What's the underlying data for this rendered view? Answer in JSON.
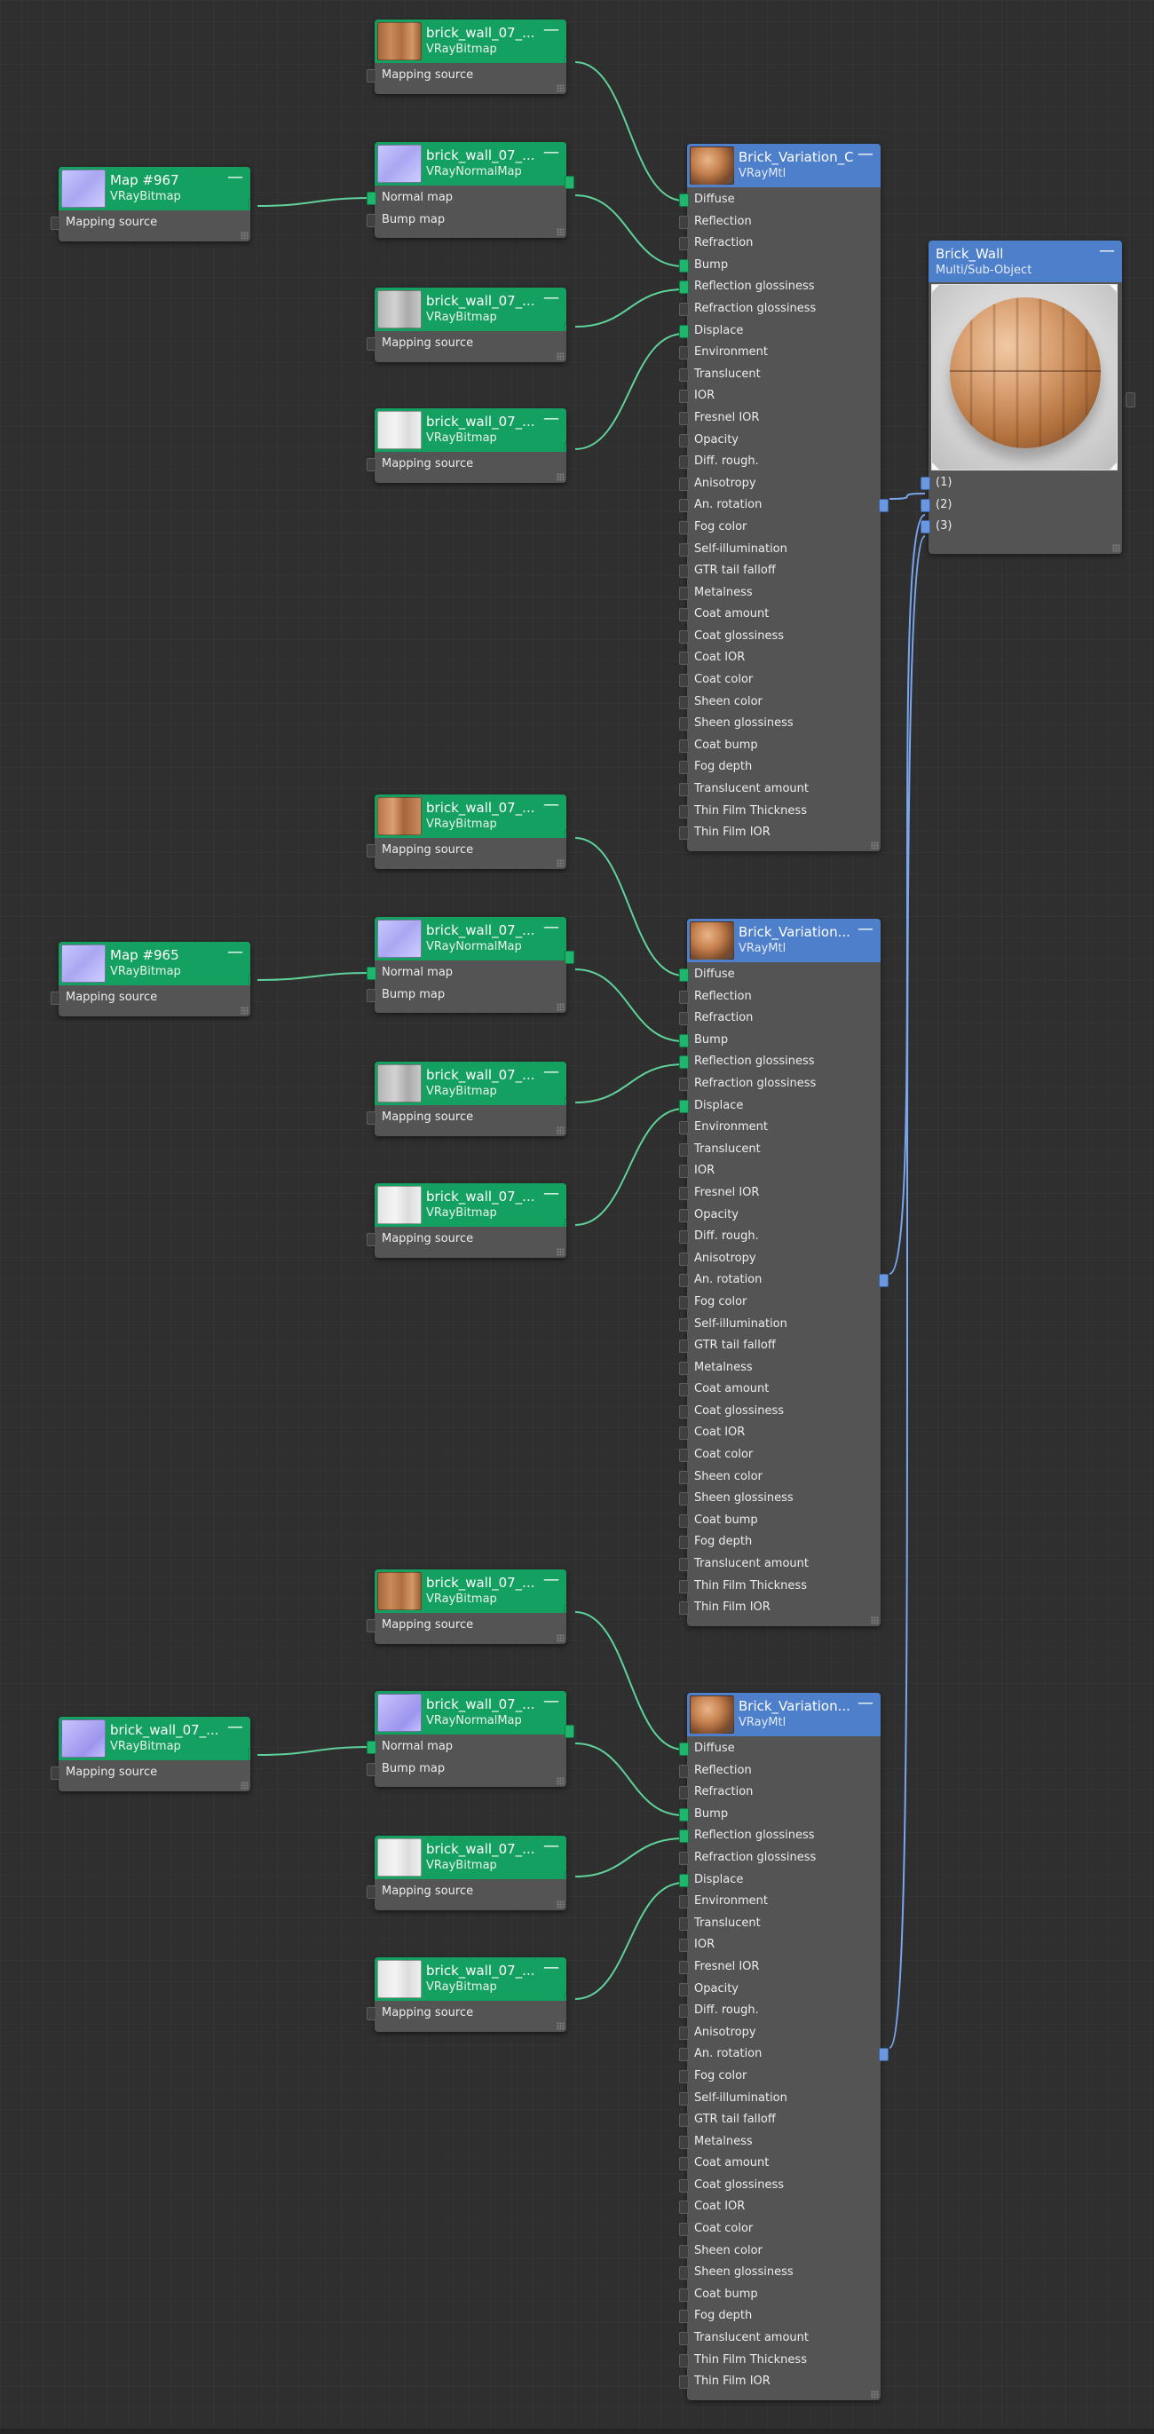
{
  "multi_node": {
    "title": "Brick_Wall",
    "subtitle": "Multi/Sub-Object",
    "slots": [
      "(1)",
      "(2)",
      "(3)"
    ]
  },
  "materials": [
    {
      "title": "Brick_Variation_C",
      "subtitle": "VRayMtl",
      "slots": [
        "Diffuse",
        "Reflection",
        "Refraction",
        "Bump",
        "Reflection glossiness",
        "Refraction glossiness",
        "Displace",
        "Environment",
        "Translucent",
        "IOR",
        "Fresnel IOR",
        "Opacity",
        "Diff. rough.",
        "Anisotropy",
        "An. rotation",
        "Fog color",
        "Self-illumination",
        "GTR tail falloff",
        "Metalness",
        "Coat amount",
        "Coat glossiness",
        "Coat IOR",
        "Coat color",
        "Sheen color",
        "Sheen glossiness",
        "Coat bump",
        "Fog depth",
        "Translucent amount",
        "Thin Film Thickness",
        "Thin Film IOR"
      ],
      "bitmaps": [
        {
          "title": "brick_wall_07_...",
          "subtitle": "VRayBitmap",
          "slots": [
            "Mapping source"
          ]
        },
        {
          "title": "brick_wall_07_...",
          "subtitle": "VRayNormalMap",
          "slots": [
            "Normal map",
            "Bump map"
          ]
        },
        {
          "title": "brick_wall_07_...",
          "subtitle": "VRayBitmap",
          "slots": [
            "Mapping source"
          ]
        },
        {
          "title": "brick_wall_07_...",
          "subtitle": "VRayBitmap",
          "slots": [
            "Mapping source"
          ]
        }
      ],
      "source_map": {
        "title": "Map #967",
        "subtitle": "VRayBitmap",
        "slots": [
          "Mapping source"
        ]
      }
    },
    {
      "title": "Brick_Variation...",
      "subtitle": "VRayMtl",
      "slots": [
        "Diffuse",
        "Reflection",
        "Refraction",
        "Bump",
        "Reflection glossiness",
        "Refraction glossiness",
        "Displace",
        "Environment",
        "Translucent",
        "IOR",
        "Fresnel IOR",
        "Opacity",
        "Diff. rough.",
        "Anisotropy",
        "An. rotation",
        "Fog color",
        "Self-illumination",
        "GTR tail falloff",
        "Metalness",
        "Coat amount",
        "Coat glossiness",
        "Coat IOR",
        "Coat color",
        "Sheen color",
        "Sheen glossiness",
        "Coat bump",
        "Fog depth",
        "Translucent amount",
        "Thin Film Thickness",
        "Thin Film IOR"
      ],
      "bitmaps": [
        {
          "title": "brick_wall_07_...",
          "subtitle": "VRayBitmap",
          "slots": [
            "Mapping source"
          ]
        },
        {
          "title": "brick_wall_07_...",
          "subtitle": "VRayNormalMap",
          "slots": [
            "Normal map",
            "Bump map"
          ]
        },
        {
          "title": "brick_wall_07_...",
          "subtitle": "VRayBitmap",
          "slots": [
            "Mapping source"
          ]
        },
        {
          "title": "brick_wall_07_...",
          "subtitle": "VRayBitmap",
          "slots": [
            "Mapping source"
          ]
        }
      ],
      "source_map": {
        "title": "Map #965",
        "subtitle": "VRayBitmap",
        "slots": [
          "Mapping source"
        ]
      }
    },
    {
      "title": "Brick_Variation...",
      "subtitle": "VRayMtl",
      "slots": [
        "Diffuse",
        "Reflection",
        "Refraction",
        "Bump",
        "Reflection glossiness",
        "Refraction glossiness",
        "Displace",
        "Environment",
        "Translucent",
        "IOR",
        "Fresnel IOR",
        "Opacity",
        "Diff. rough.",
        "Anisotropy",
        "An. rotation",
        "Fog color",
        "Self-illumination",
        "GTR tail falloff",
        "Metalness",
        "Coat amount",
        "Coat glossiness",
        "Coat IOR",
        "Coat color",
        "Sheen color",
        "Sheen glossiness",
        "Coat bump",
        "Fog depth",
        "Translucent amount",
        "Thin Film Thickness",
        "Thin Film IOR"
      ],
      "bitmaps": [
        {
          "title": "brick_wall_07_...",
          "subtitle": "VRayBitmap",
          "slots": [
            "Mapping source"
          ]
        },
        {
          "title": "brick_wall_07_...",
          "subtitle": "VRayNormalMap",
          "slots": [
            "Normal map",
            "Bump map"
          ]
        },
        {
          "title": "brick_wall_07_...",
          "subtitle": "VRayBitmap",
          "slots": [
            "Mapping source"
          ]
        },
        {
          "title": "brick_wall_07_...",
          "subtitle": "VRayBitmap",
          "slots": [
            "Mapping source"
          ]
        }
      ],
      "source_map": {
        "title": "brick_wall_07_...",
        "subtitle": "VRayBitmap",
        "slots": [
          "Mapping source"
        ]
      }
    }
  ],
  "collapse_symbol": "—",
  "colors": {
    "canvas": "#2f2f2f",
    "node_body": "#545454",
    "map_header": "#14a060",
    "material_header": "#4d7fcb",
    "map_wire": "#5fd29a",
    "material_wire": "#7aa6ee"
  }
}
